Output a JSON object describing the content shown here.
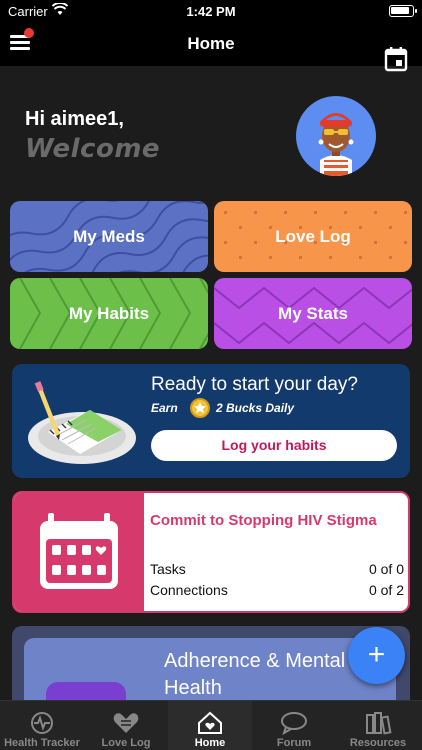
{
  "status_bar": {
    "carrier": "Carrier",
    "time": "1:42 PM"
  },
  "nav": {
    "title": "Home"
  },
  "greeting": {
    "hello": "Hi aimee1,",
    "welcome": "Welcome"
  },
  "tiles": [
    {
      "label": "My Meds",
      "color": "#5b72c4"
    },
    {
      "label": "Love Log",
      "color": "#f7964a"
    },
    {
      "label": "My Habits",
      "color": "#6cc04a"
    },
    {
      "label": "My Stats",
      "color": "#b94fe4"
    }
  ],
  "day_card": {
    "title": "Ready to start your day?",
    "earn": "Earn",
    "bucks": "2 Bucks Daily",
    "button": "Log your habits"
  },
  "hiv_card": {
    "title": "Commit to Stopping HIV Stigma",
    "rows": [
      {
        "label": "Tasks",
        "value": "0 of 0"
      },
      {
        "label": "Connections",
        "value": "0 of 2"
      }
    ]
  },
  "adherence_card": {
    "title": "Adherence & Mental Health"
  },
  "fab": {
    "label": "+"
  },
  "tabs": [
    {
      "label": "Health Tracker",
      "icon": "health-tracker-icon"
    },
    {
      "label": "Love Log",
      "icon": "heart-icon"
    },
    {
      "label": "Home",
      "icon": "home-icon",
      "active": true
    },
    {
      "label": "Forum",
      "icon": "chat-bubble-icon"
    },
    {
      "label": "Resources",
      "icon": "books-icon"
    }
  ],
  "colors": {
    "background": "#1c1c1c",
    "day_card": "#123a6c",
    "hiv_accent": "#d63a6c",
    "fab": "#3b82f6"
  }
}
